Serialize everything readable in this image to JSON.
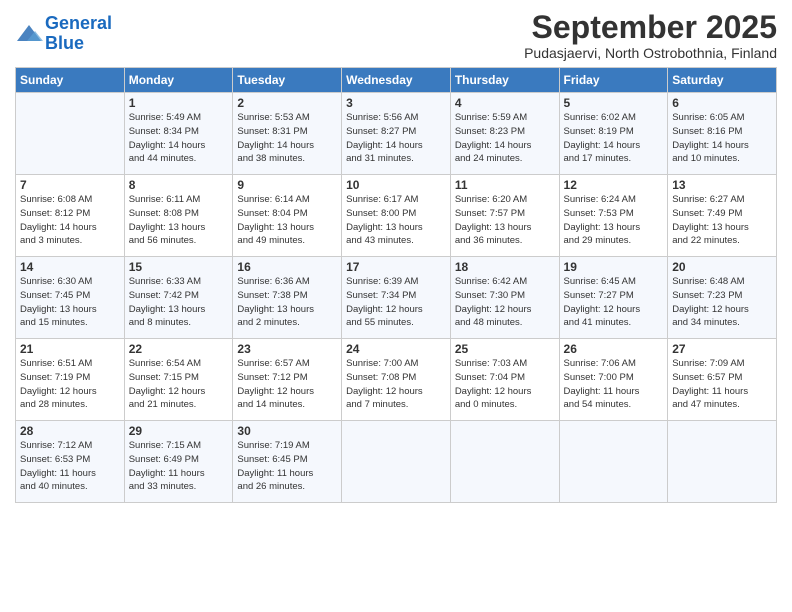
{
  "header": {
    "logo_line1": "General",
    "logo_line2": "Blue",
    "month": "September 2025",
    "location": "Pudasjaervi, North Ostrobothnia, Finland"
  },
  "days_of_week": [
    "Sunday",
    "Monday",
    "Tuesday",
    "Wednesday",
    "Thursday",
    "Friday",
    "Saturday"
  ],
  "weeks": [
    [
      {
        "day": "",
        "info": ""
      },
      {
        "day": "1",
        "info": "Sunrise: 5:49 AM\nSunset: 8:34 PM\nDaylight: 14 hours\nand 44 minutes."
      },
      {
        "day": "2",
        "info": "Sunrise: 5:53 AM\nSunset: 8:31 PM\nDaylight: 14 hours\nand 38 minutes."
      },
      {
        "day": "3",
        "info": "Sunrise: 5:56 AM\nSunset: 8:27 PM\nDaylight: 14 hours\nand 31 minutes."
      },
      {
        "day": "4",
        "info": "Sunrise: 5:59 AM\nSunset: 8:23 PM\nDaylight: 14 hours\nand 24 minutes."
      },
      {
        "day": "5",
        "info": "Sunrise: 6:02 AM\nSunset: 8:19 PM\nDaylight: 14 hours\nand 17 minutes."
      },
      {
        "day": "6",
        "info": "Sunrise: 6:05 AM\nSunset: 8:16 PM\nDaylight: 14 hours\nand 10 minutes."
      }
    ],
    [
      {
        "day": "7",
        "info": "Sunrise: 6:08 AM\nSunset: 8:12 PM\nDaylight: 14 hours\nand 3 minutes."
      },
      {
        "day": "8",
        "info": "Sunrise: 6:11 AM\nSunset: 8:08 PM\nDaylight: 13 hours\nand 56 minutes."
      },
      {
        "day": "9",
        "info": "Sunrise: 6:14 AM\nSunset: 8:04 PM\nDaylight: 13 hours\nand 49 minutes."
      },
      {
        "day": "10",
        "info": "Sunrise: 6:17 AM\nSunset: 8:00 PM\nDaylight: 13 hours\nand 43 minutes."
      },
      {
        "day": "11",
        "info": "Sunrise: 6:20 AM\nSunset: 7:57 PM\nDaylight: 13 hours\nand 36 minutes."
      },
      {
        "day": "12",
        "info": "Sunrise: 6:24 AM\nSunset: 7:53 PM\nDaylight: 13 hours\nand 29 minutes."
      },
      {
        "day": "13",
        "info": "Sunrise: 6:27 AM\nSunset: 7:49 PM\nDaylight: 13 hours\nand 22 minutes."
      }
    ],
    [
      {
        "day": "14",
        "info": "Sunrise: 6:30 AM\nSunset: 7:45 PM\nDaylight: 13 hours\nand 15 minutes."
      },
      {
        "day": "15",
        "info": "Sunrise: 6:33 AM\nSunset: 7:42 PM\nDaylight: 13 hours\nand 8 minutes."
      },
      {
        "day": "16",
        "info": "Sunrise: 6:36 AM\nSunset: 7:38 PM\nDaylight: 13 hours\nand 2 minutes."
      },
      {
        "day": "17",
        "info": "Sunrise: 6:39 AM\nSunset: 7:34 PM\nDaylight: 12 hours\nand 55 minutes."
      },
      {
        "day": "18",
        "info": "Sunrise: 6:42 AM\nSunset: 7:30 PM\nDaylight: 12 hours\nand 48 minutes."
      },
      {
        "day": "19",
        "info": "Sunrise: 6:45 AM\nSunset: 7:27 PM\nDaylight: 12 hours\nand 41 minutes."
      },
      {
        "day": "20",
        "info": "Sunrise: 6:48 AM\nSunset: 7:23 PM\nDaylight: 12 hours\nand 34 minutes."
      }
    ],
    [
      {
        "day": "21",
        "info": "Sunrise: 6:51 AM\nSunset: 7:19 PM\nDaylight: 12 hours\nand 28 minutes."
      },
      {
        "day": "22",
        "info": "Sunrise: 6:54 AM\nSunset: 7:15 PM\nDaylight: 12 hours\nand 21 minutes."
      },
      {
        "day": "23",
        "info": "Sunrise: 6:57 AM\nSunset: 7:12 PM\nDaylight: 12 hours\nand 14 minutes."
      },
      {
        "day": "24",
        "info": "Sunrise: 7:00 AM\nSunset: 7:08 PM\nDaylight: 12 hours\nand 7 minutes."
      },
      {
        "day": "25",
        "info": "Sunrise: 7:03 AM\nSunset: 7:04 PM\nDaylight: 12 hours\nand 0 minutes."
      },
      {
        "day": "26",
        "info": "Sunrise: 7:06 AM\nSunset: 7:00 PM\nDaylight: 11 hours\nand 54 minutes."
      },
      {
        "day": "27",
        "info": "Sunrise: 7:09 AM\nSunset: 6:57 PM\nDaylight: 11 hours\nand 47 minutes."
      }
    ],
    [
      {
        "day": "28",
        "info": "Sunrise: 7:12 AM\nSunset: 6:53 PM\nDaylight: 11 hours\nand 40 minutes."
      },
      {
        "day": "29",
        "info": "Sunrise: 7:15 AM\nSunset: 6:49 PM\nDaylight: 11 hours\nand 33 minutes."
      },
      {
        "day": "30",
        "info": "Sunrise: 7:19 AM\nSunset: 6:45 PM\nDaylight: 11 hours\nand 26 minutes."
      },
      {
        "day": "",
        "info": ""
      },
      {
        "day": "",
        "info": ""
      },
      {
        "day": "",
        "info": ""
      },
      {
        "day": "",
        "info": ""
      }
    ]
  ]
}
